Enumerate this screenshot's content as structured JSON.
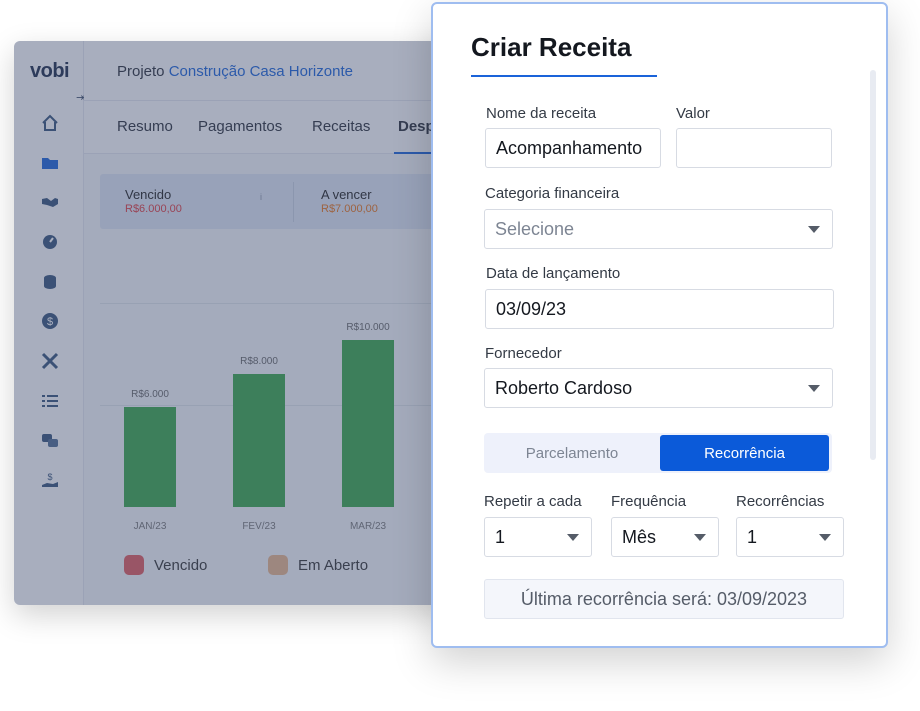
{
  "app": {
    "logo": "vobi",
    "project_prefix": "Projeto",
    "project_name": "Construção Casa Horizonte",
    "tabs": [
      {
        "label": "Resumo"
      },
      {
        "label": "Pagamentos"
      },
      {
        "label": "Receitas"
      },
      {
        "label": "Desp"
      }
    ],
    "cards": [
      {
        "label": "Vencido",
        "value": "R$6.000,00",
        "color": "#e0393e"
      },
      {
        "label": "A vencer",
        "value": "R$7.000,00",
        "color": "#e8731a"
      }
    ],
    "card_info_icon": "i",
    "sidebar_icons": [
      "home-icon",
      "folder-icon",
      "handshake-icon",
      "gauge-icon",
      "coins-icon",
      "dollar-icon",
      "tools-icon",
      "list-icon",
      "chat-icon",
      "money-hand-icon"
    ],
    "legend": [
      {
        "label": "Vencido",
        "color": "#e05a5e"
      },
      {
        "label": "Em Aberto",
        "color": "#e8b48a"
      }
    ]
  },
  "chart_data": {
    "type": "bar",
    "categories": [
      "JAN/23",
      "FEV/23",
      "MAR/23"
    ],
    "values": [
      6000,
      8000,
      10000
    ],
    "data_labels": [
      "R$6.000",
      "R$8.000",
      "R$10.000"
    ],
    "ylim": [
      0,
      12000
    ],
    "color": "#3aa64a"
  },
  "modal": {
    "title": "Criar Receita",
    "nome_label": "Nome da receita",
    "nome_value": "Acompanhamento",
    "valor_label": "Valor",
    "valor_value": "",
    "categoria_label": "Categoria financeira",
    "categoria_placeholder": "Selecione",
    "data_label": "Data de lançamento",
    "data_value": "03/09/23",
    "fornecedor_label": "Fornecedor",
    "fornecedor_value": "Roberto Cardoso",
    "seg_parcelamento": "Parcelamento",
    "seg_recorrencia": "Recorrência",
    "repetir_label": "Repetir a cada",
    "repetir_value": "1",
    "frequencia_label": "Frequência",
    "frequencia_value": "Mês",
    "recorrencias_label": "Recorrências",
    "recorrencias_value": "1",
    "ultima_info": "Última recorrência será: 03/09/2023"
  }
}
